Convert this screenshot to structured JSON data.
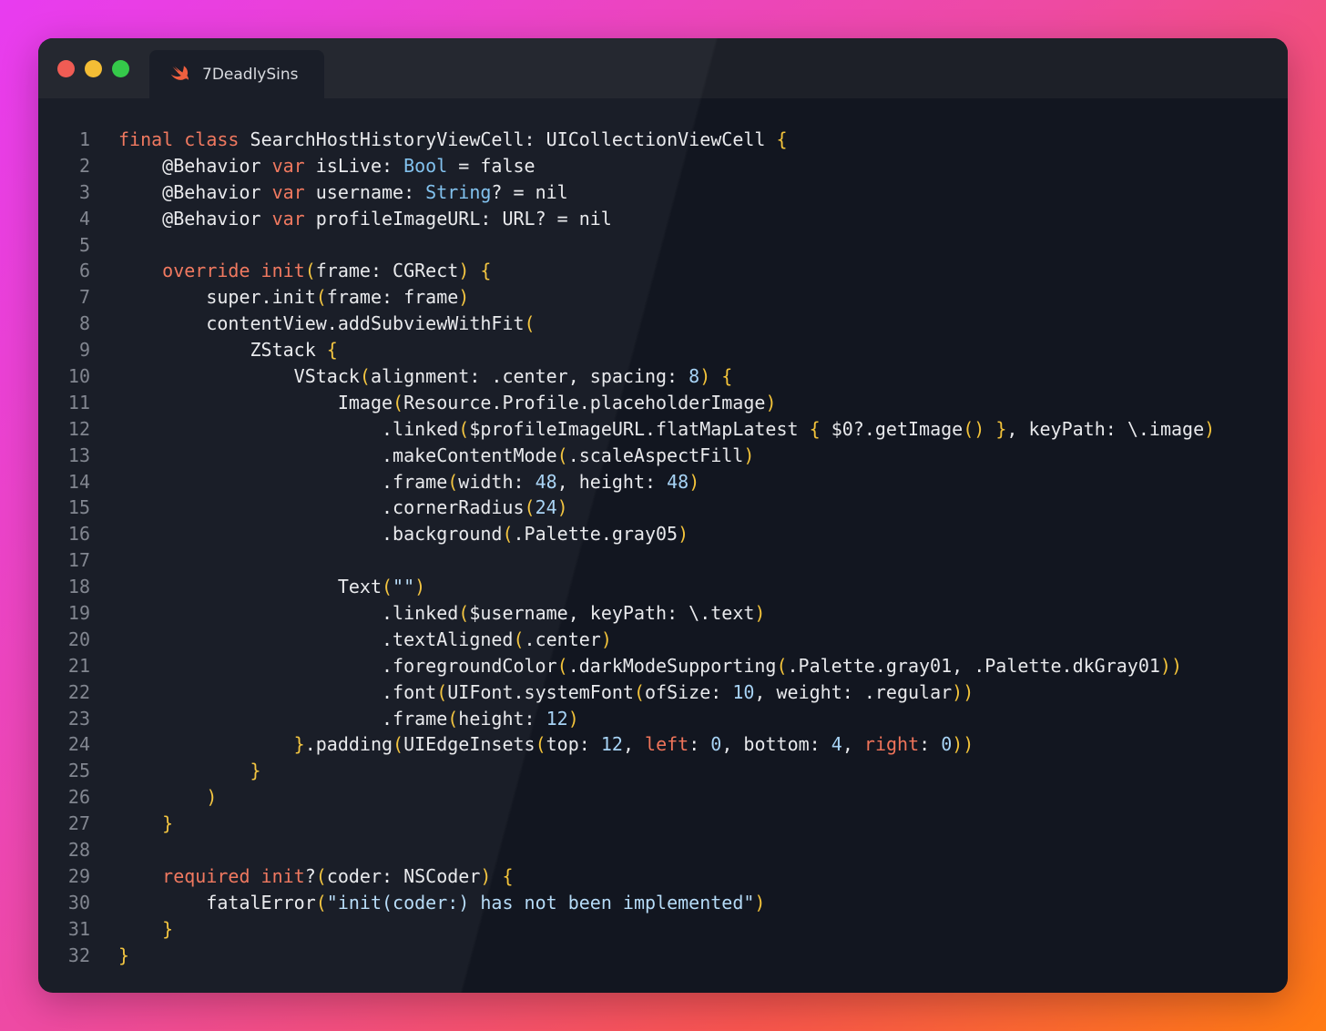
{
  "tab": {
    "title": "7DeadlySins",
    "icon": "swift-icon"
  },
  "colors": {
    "keyword": "#f0745a",
    "type": "#7ec0ee",
    "number": "#a7d3f5",
    "string": "#b5dbf7",
    "bracket": "#f3c33a",
    "plain": "#e8e9ec",
    "line_number": "#7d828c"
  },
  "lines": [
    {
      "n": "1",
      "tokens": [
        [
          "kw",
          "final"
        ],
        [
          "pl",
          " "
        ],
        [
          "kw",
          "class"
        ],
        [
          "pl",
          " SearchHostHistoryViewCell: UICollectionViewCell "
        ],
        [
          "br",
          "{"
        ]
      ]
    },
    {
      "n": "2",
      "tokens": [
        [
          "pl",
          "    @Behavior "
        ],
        [
          "kw",
          "var"
        ],
        [
          "pl",
          " isLive: "
        ],
        [
          "ty",
          "Bool"
        ],
        [
          "pl",
          " = false"
        ]
      ]
    },
    {
      "n": "3",
      "tokens": [
        [
          "pl",
          "    @Behavior "
        ],
        [
          "kw",
          "var"
        ],
        [
          "pl",
          " username: "
        ],
        [
          "ty",
          "String"
        ],
        [
          "pl",
          "? = nil"
        ]
      ]
    },
    {
      "n": "4",
      "tokens": [
        [
          "pl",
          "    @Behavior "
        ],
        [
          "kw",
          "var"
        ],
        [
          "pl",
          " profileImageURL: URL? = nil"
        ]
      ]
    },
    {
      "n": "5",
      "tokens": []
    },
    {
      "n": "6",
      "tokens": [
        [
          "pl",
          "    "
        ],
        [
          "kw",
          "override"
        ],
        [
          "pl",
          " "
        ],
        [
          "kw",
          "init"
        ],
        [
          "br",
          "("
        ],
        [
          "pl",
          "frame: CGRect"
        ],
        [
          "br",
          ")"
        ],
        [
          "pl",
          " "
        ],
        [
          "br",
          "{"
        ]
      ]
    },
    {
      "n": "7",
      "tokens": [
        [
          "pl",
          "        super.init"
        ],
        [
          "br",
          "("
        ],
        [
          "pl",
          "frame: frame"
        ],
        [
          "br",
          ")"
        ]
      ]
    },
    {
      "n": "8",
      "tokens": [
        [
          "pl",
          "        contentView.addSubviewWithFit"
        ],
        [
          "br",
          "("
        ]
      ]
    },
    {
      "n": "9",
      "tokens": [
        [
          "pl",
          "            ZStack "
        ],
        [
          "br",
          "{"
        ]
      ]
    },
    {
      "n": "10",
      "tokens": [
        [
          "pl",
          "                VStack"
        ],
        [
          "br",
          "("
        ],
        [
          "pl",
          "alignment: .center, spacing: "
        ],
        [
          "nm",
          "8"
        ],
        [
          "br",
          ")"
        ],
        [
          "pl",
          " "
        ],
        [
          "br",
          "{"
        ]
      ]
    },
    {
      "n": "11",
      "tokens": [
        [
          "pl",
          "                    Image"
        ],
        [
          "br",
          "("
        ],
        [
          "pl",
          "Resource.Profile.placeholderImage"
        ],
        [
          "br",
          ")"
        ]
      ]
    },
    {
      "n": "12",
      "tokens": [
        [
          "pl",
          "                        .linked"
        ],
        [
          "br",
          "("
        ],
        [
          "pl",
          "$profileImageURL.flatMapLatest "
        ],
        [
          "br",
          "{"
        ],
        [
          "pl",
          " $0?.getImage"
        ],
        [
          "br",
          "()"
        ],
        [
          "pl",
          " "
        ],
        [
          "br",
          "}"
        ],
        [
          "pl",
          ", keyPath: \\.image"
        ],
        [
          "br",
          ")"
        ]
      ]
    },
    {
      "n": "13",
      "tokens": [
        [
          "pl",
          "                        .makeContentMode"
        ],
        [
          "br",
          "("
        ],
        [
          "pl",
          ".scaleAspectFill"
        ],
        [
          "br",
          ")"
        ]
      ]
    },
    {
      "n": "14",
      "tokens": [
        [
          "pl",
          "                        .frame"
        ],
        [
          "br",
          "("
        ],
        [
          "pl",
          "width: "
        ],
        [
          "nm",
          "48"
        ],
        [
          "pl",
          ", height: "
        ],
        [
          "nm",
          "48"
        ],
        [
          "br",
          ")"
        ]
      ]
    },
    {
      "n": "15",
      "tokens": [
        [
          "pl",
          "                        .cornerRadius"
        ],
        [
          "br",
          "("
        ],
        [
          "nm",
          "24"
        ],
        [
          "br",
          ")"
        ]
      ]
    },
    {
      "n": "16",
      "tokens": [
        [
          "pl",
          "                        .background"
        ],
        [
          "br",
          "("
        ],
        [
          "pl",
          ".Palette.gray05"
        ],
        [
          "br",
          ")"
        ]
      ]
    },
    {
      "n": "17",
      "tokens": []
    },
    {
      "n": "18",
      "tokens": [
        [
          "pl",
          "                    Text"
        ],
        [
          "br",
          "("
        ],
        [
          "st",
          "\"\""
        ],
        [
          "br",
          ")"
        ]
      ]
    },
    {
      "n": "19",
      "tokens": [
        [
          "pl",
          "                        .linked"
        ],
        [
          "br",
          "("
        ],
        [
          "pl",
          "$username, keyPath: \\.text"
        ],
        [
          "br",
          ")"
        ]
      ]
    },
    {
      "n": "20",
      "tokens": [
        [
          "pl",
          "                        .textAligned"
        ],
        [
          "br",
          "("
        ],
        [
          "pl",
          ".center"
        ],
        [
          "br",
          ")"
        ]
      ]
    },
    {
      "n": "21",
      "tokens": [
        [
          "pl",
          "                        .foregroundColor"
        ],
        [
          "br",
          "("
        ],
        [
          "pl",
          ".darkModeSupporting"
        ],
        [
          "br",
          "("
        ],
        [
          "pl",
          ".Palette.gray01, .Palette.dkGray01"
        ],
        [
          "br",
          "))"
        ]
      ]
    },
    {
      "n": "22",
      "tokens": [
        [
          "pl",
          "                        .font"
        ],
        [
          "br",
          "("
        ],
        [
          "pl",
          "UIFont.systemFont"
        ],
        [
          "br",
          "("
        ],
        [
          "pl",
          "ofSize: "
        ],
        [
          "nm",
          "10"
        ],
        [
          "pl",
          ", weight: .regular"
        ],
        [
          "br",
          "))"
        ]
      ]
    },
    {
      "n": "23",
      "tokens": [
        [
          "pl",
          "                        .frame"
        ],
        [
          "br",
          "("
        ],
        [
          "pl",
          "height: "
        ],
        [
          "nm",
          "12"
        ],
        [
          "br",
          ")"
        ]
      ]
    },
    {
      "n": "24",
      "tokens": [
        [
          "pl",
          "                "
        ],
        [
          "br",
          "}"
        ],
        [
          "pl",
          ".padding"
        ],
        [
          "br",
          "("
        ],
        [
          "pl",
          "UIEdgeInsets"
        ],
        [
          "br",
          "("
        ],
        [
          "pl",
          "top: "
        ],
        [
          "nm",
          "12"
        ],
        [
          "pl",
          ", "
        ],
        [
          "kw",
          "left"
        ],
        [
          "pl",
          ": "
        ],
        [
          "nm",
          "0"
        ],
        [
          "pl",
          ", bottom: "
        ],
        [
          "nm",
          "4"
        ],
        [
          "pl",
          ", "
        ],
        [
          "kw",
          "right"
        ],
        [
          "pl",
          ": "
        ],
        [
          "nm",
          "0"
        ],
        [
          "br",
          "))"
        ]
      ]
    },
    {
      "n": "25",
      "tokens": [
        [
          "pl",
          "            "
        ],
        [
          "br",
          "}"
        ]
      ]
    },
    {
      "n": "26",
      "tokens": [
        [
          "pl",
          "        "
        ],
        [
          "br",
          ")"
        ]
      ]
    },
    {
      "n": "27",
      "tokens": [
        [
          "pl",
          "    "
        ],
        [
          "br",
          "}"
        ]
      ]
    },
    {
      "n": "28",
      "tokens": []
    },
    {
      "n": "29",
      "tokens": [
        [
          "pl",
          "    "
        ],
        [
          "kw",
          "required"
        ],
        [
          "pl",
          " "
        ],
        [
          "kw",
          "init"
        ],
        [
          "pl",
          "?"
        ],
        [
          "br",
          "("
        ],
        [
          "pl",
          "coder: NSCoder"
        ],
        [
          "br",
          ")"
        ],
        [
          "pl",
          " "
        ],
        [
          "br",
          "{"
        ]
      ]
    },
    {
      "n": "30",
      "tokens": [
        [
          "pl",
          "        fatalError"
        ],
        [
          "br",
          "("
        ],
        [
          "st",
          "\"init(coder:) has not been implemented\""
        ],
        [
          "br",
          ")"
        ]
      ]
    },
    {
      "n": "31",
      "tokens": [
        [
          "pl",
          "    "
        ],
        [
          "br",
          "}"
        ]
      ]
    },
    {
      "n": "32",
      "tokens": [
        [
          "br",
          "}"
        ]
      ]
    }
  ]
}
